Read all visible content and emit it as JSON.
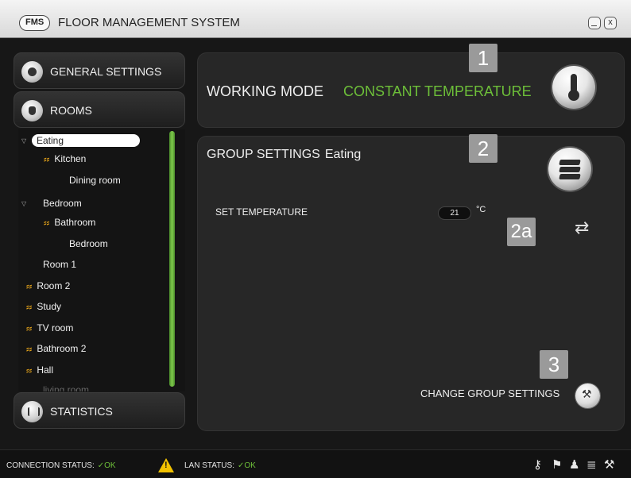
{
  "window": {
    "logo": "FMS",
    "title": "FLOOR MANAGEMENT SYSTEM",
    "minimize_icon": "minimize-icon",
    "close_icon": "close-icon",
    "close_glyph": "x"
  },
  "nav": {
    "general_settings": "GENERAL SETTINGS",
    "rooms": "ROOMS",
    "statistics": "STATISTICS"
  },
  "rooms": [
    {
      "label": "Eating",
      "selected": true,
      "group": true,
      "heating": false
    },
    {
      "label": "Kitchen",
      "heating": true
    },
    {
      "label": "Dining room",
      "heating": false
    },
    {
      "label": "Bedroom",
      "group": true,
      "heating": false
    },
    {
      "label": "Bathroom",
      "heating": true
    },
    {
      "label": "Bedroom",
      "heating": false
    },
    {
      "label": "Room 1",
      "heating": false
    },
    {
      "label": "Room 2",
      "heating": true
    },
    {
      "label": "Study",
      "heating": true
    },
    {
      "label": "TV room",
      "heating": true
    },
    {
      "label": "Bathroom 2",
      "heating": true
    },
    {
      "label": "Hall",
      "heating": true
    },
    {
      "label": "living room",
      "heating": false
    }
  ],
  "working_mode": {
    "label": "WORKING MODE",
    "value": "CONSTANT TEMPERATURE",
    "value_color": "#6dbf39"
  },
  "group_settings": {
    "label": "GROUP SETTINGS",
    "group_name": "Eating",
    "set_temperature_label": "SET TEMPERATURE",
    "temperature_value": "21",
    "temperature_unit": "°C",
    "change_label": "CHANGE GROUP SETTINGS"
  },
  "markers": {
    "m1": "1",
    "m2": "2",
    "m2a": "2a",
    "m3": "3"
  },
  "status": {
    "connection_label": "CONNECTION STATUS:",
    "connection_value": "✓OK",
    "lan_label": "LAN STATUS:",
    "lan_value": "✓OK",
    "ok_color": "#6dbf39",
    "warning_color": "#f2c200"
  },
  "toolbar_icons": [
    "key-icon",
    "flag-icon",
    "user-icon",
    "layers-icon",
    "tools-icon"
  ]
}
